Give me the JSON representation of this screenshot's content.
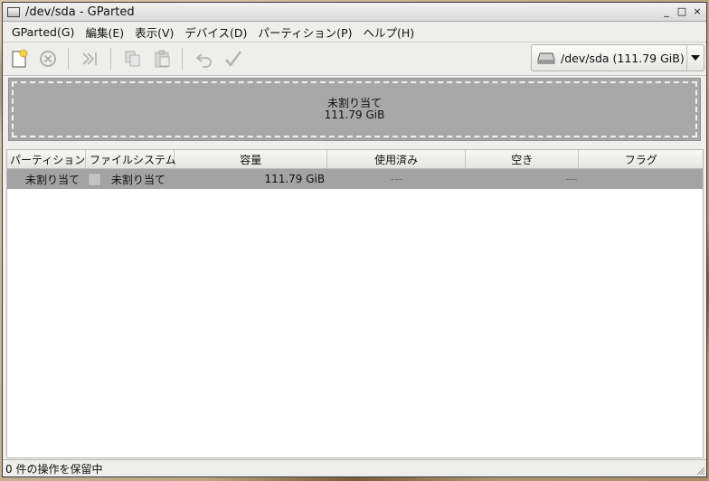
{
  "window": {
    "title": "/dev/sda - GParted",
    "controls": [
      "_",
      "□",
      "×"
    ]
  },
  "menu": [
    {
      "label": "GParted(G)"
    },
    {
      "label": "編集(E)"
    },
    {
      "label": "表示(V)"
    },
    {
      "label": "デバイス(D)"
    },
    {
      "label": "パーティション(P)"
    },
    {
      "label": "ヘルプ(H)"
    }
  ],
  "toolbar": {
    "icons": [
      "new-partition-icon",
      "delete-icon",
      "resize-move-icon",
      "copy-icon",
      "paste-icon",
      "undo-icon",
      "apply-icon"
    ],
    "device": {
      "label": "/dev/sda  (111.79 GiB)"
    }
  },
  "disk_map": {
    "line1": "未割り当て",
    "line2": "111.79 GiB",
    "fill_color": "#a8a8a8"
  },
  "table": {
    "columns": [
      "パーティション",
      "ファイルシステム",
      "容量",
      "使用済み",
      "空き",
      "フラグ"
    ],
    "rows": [
      {
        "partition": "未割り当て",
        "filesystem": "未割り当て",
        "size": "111.79 GiB",
        "used": "---",
        "free": "---",
        "flags": ""
      }
    ]
  },
  "status": {
    "text": "0 件の操作を保留中"
  }
}
